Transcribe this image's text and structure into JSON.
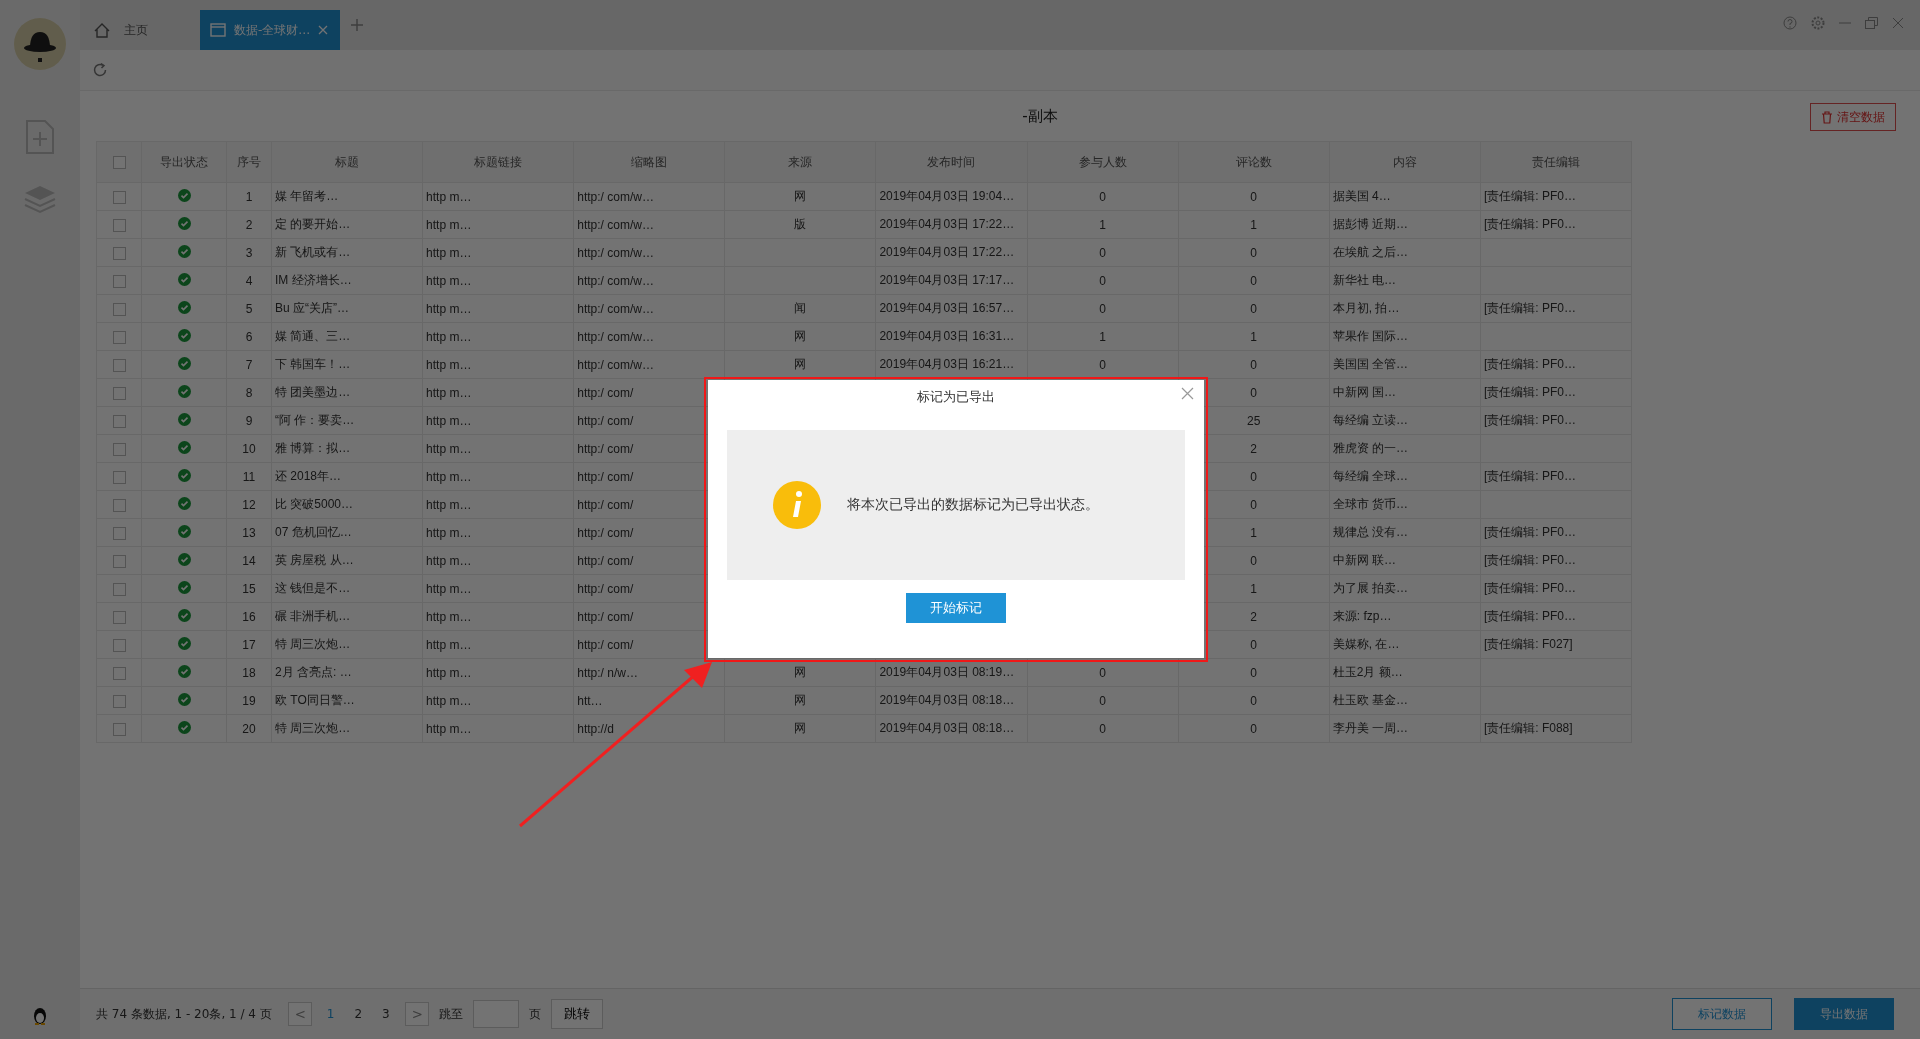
{
  "tabs": [
    {
      "kind": "home",
      "label": "主页",
      "selected": false
    },
    {
      "kind": "page",
      "label": "数据-全球财…",
      "selected": true
    }
  ],
  "page_title": "-副本",
  "clear_button": "清空数据",
  "table": {
    "select_all_checked": false,
    "columns": [
      "导出状态",
      "序号",
      "标题",
      "标题链接",
      "缩略图",
      "来源",
      "发布时间",
      "参与人数",
      "评论数",
      "内容",
      "责任编辑"
    ],
    "rows": [
      {
        "checked": false,
        "exported": true,
        "index": "1",
        "title": "媒 年留考…",
        "link": "http m…",
        "thumb": "http:/ com/w…",
        "source": "网",
        "time": "2019年04月03日 19:04…",
        "participants": "0",
        "comments": "0",
        "content": "据美国 4…",
        "editor": "[责任编辑: PF0…"
      },
      {
        "checked": false,
        "exported": true,
        "index": "2",
        "title": "定 的要开始…",
        "link": "http m…",
        "thumb": "http:/ com/w…",
        "source": "版",
        "time": "2019年04月03日 17:22…",
        "participants": "1",
        "comments": "1",
        "content": "据彭博 近期…",
        "editor": "[责任编辑: PF0…"
      },
      {
        "checked": false,
        "exported": true,
        "index": "3",
        "title": "新 飞机或有…",
        "link": "http m…",
        "thumb": "http:/ com/w…",
        "time": "2019年04月03日 17:22…",
        "participants": "0",
        "comments": "0",
        "content": "在埃航 之后…"
      },
      {
        "checked": false,
        "exported": true,
        "index": "4",
        "title": "IM 经济增长…",
        "link": "http m…",
        "thumb": "http:/ com/w…",
        "time": "2019年04月03日 17:17…",
        "participants": "0",
        "comments": "0",
        "content": "新华社 电…"
      },
      {
        "checked": false,
        "exported": true,
        "index": "5",
        "title": "Bu 应“关店”…",
        "link": "http m…",
        "thumb": "http:/ com/w…",
        "source": "闻",
        "time": "2019年04月03日 16:57…",
        "participants": "0",
        "comments": "0",
        "content": "本月初, 拍…",
        "editor": "[责任编辑: PF0…"
      },
      {
        "checked": false,
        "exported": true,
        "index": "6",
        "title": "媒 简通、三…",
        "link": "http m…",
        "thumb": "http:/ com/w…",
        "source": "网",
        "time": "2019年04月03日 16:31…",
        "participants": "1",
        "comments": "1",
        "content": "苹果作 国际…"
      },
      {
        "checked": false,
        "exported": true,
        "index": "7",
        "title": "下 韩国车！…",
        "link": "http m…",
        "thumb": "http:/ com/w…",
        "source": "网",
        "time": "2019年04月03日 16:21…",
        "participants": "0",
        "comments": "0",
        "content": "美国国 全管…",
        "editor": "[责任编辑: PF0…"
      },
      {
        "checked": false,
        "exported": true,
        "index": "8",
        "title": "特 团美墨边…",
        "link": "http m…",
        "thumb": "http:/ com/",
        "comments": "0",
        "content": "中新网 国…",
        "editor": "[责任编辑: PF0…"
      },
      {
        "checked": false,
        "exported": true,
        "index": "9",
        "title": "“阿 作：要卖…",
        "link": "http m…",
        "thumb": "http:/ com/",
        "comments": "25",
        "content": "每经编 立读…",
        "editor": "[责任编辑: PF0…"
      },
      {
        "checked": false,
        "exported": true,
        "index": "10",
        "title": "雅 博算：拟…",
        "link": "http m…",
        "thumb": "http:/ com/",
        "comments": "2",
        "content": "雅虎资 的一…"
      },
      {
        "checked": false,
        "exported": true,
        "index": "11",
        "title": "还 2018年…",
        "link": "http m…",
        "thumb": "http:/ com/",
        "comments": "0",
        "content": "每经编 全球…",
        "editor": "[责任编辑: PF0…"
      },
      {
        "checked": false,
        "exported": true,
        "index": "12",
        "title": "比 突破5000…",
        "link": "http m…",
        "thumb": "http:/ com/",
        "comments": "0",
        "content": "全球市 货币…"
      },
      {
        "checked": false,
        "exported": true,
        "index": "13",
        "title": "07 危机回忆…",
        "link": "http m…",
        "thumb": "http:/ com/",
        "comments": "1",
        "content": "规律总 没有…",
        "editor": "[责任编辑: PF0…"
      },
      {
        "checked": false,
        "exported": true,
        "index": "14",
        "title": "英 房屋税 从…",
        "link": "http m…",
        "thumb": "http:/ com/",
        "comments": "0",
        "content": "中新网 联…",
        "editor": "[责任编辑: PF0…"
      },
      {
        "checked": false,
        "exported": true,
        "index": "15",
        "title": "这 钱但是不…",
        "link": "http m…",
        "thumb": "http:/ com/",
        "comments": "1",
        "content": "为了展 拍卖…",
        "editor": "[责任编辑: PF0…"
      },
      {
        "checked": false,
        "exported": true,
        "index": "16",
        "title": "碾 非洲手机…",
        "link": "http m…",
        "thumb": "http:/ com/",
        "comments": "2",
        "content": "来源: fzp…",
        "editor": "[责任编辑: PF0…"
      },
      {
        "checked": false,
        "exported": true,
        "index": "17",
        "title": "特 周三次炮…",
        "link": "http m…",
        "thumb": "http:/ com/",
        "comments": "0",
        "content": "美媒称, 在…",
        "editor": "[责任编辑: F027]"
      },
      {
        "checked": false,
        "exported": true,
        "index": "18",
        "title": "2月 含亮点: …",
        "link": "http m…",
        "thumb": "http:/ n/w…",
        "source": "网",
        "time": "2019年04月03日 08:19…",
        "participants": "0",
        "comments": "0",
        "content": "杜玉2月 额…"
      },
      {
        "checked": false,
        "exported": true,
        "index": "19",
        "title": "欧 TO同日警…",
        "link": "http m…",
        "thumb": "htt…",
        "source": "网",
        "time": "2019年04月03日 08:18…",
        "participants": "0",
        "comments": "0",
        "content": "杜玉欧 基金…"
      },
      {
        "checked": false,
        "exported": true,
        "index": "20",
        "title": "特 周三次炮…",
        "link": "http m…",
        "thumb": "http://d",
        "source": "网",
        "time": "2019年04月03日 08:18…",
        "participants": "0",
        "comments": "0",
        "content": "李丹美 一周…",
        "editor": "[责任编辑: F088]"
      }
    ]
  },
  "pager": {
    "summary": "共 74 条数据, 1 - 20条, 1 / 4 页",
    "prev": "<",
    "pages": [
      {
        "label": "1",
        "selected": true
      },
      {
        "label": "2",
        "selected": false
      },
      {
        "label": "3",
        "selected": false
      }
    ],
    "next": ">",
    "goto_label": "跳至",
    "page_unit": "页",
    "goto_button": "跳转"
  },
  "footer_buttons": [
    {
      "kind": "outline",
      "label": "标记数据"
    },
    {
      "kind": "primary",
      "label": "导出数据"
    }
  ],
  "dialog": {
    "title": "标记为已导出",
    "message": "将本次已导出的数据标记为已导出状态。",
    "button": "开始标记"
  }
}
